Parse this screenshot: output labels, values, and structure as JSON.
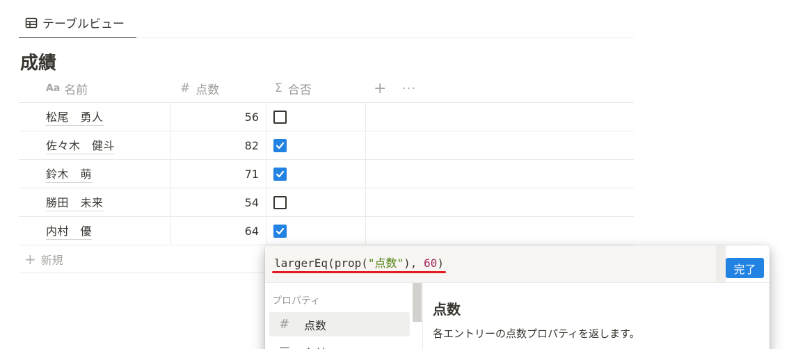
{
  "view_tab": {
    "label": "テーブルビュー",
    "icon": "table-icon"
  },
  "database": {
    "title": "成績"
  },
  "table": {
    "columns": [
      {
        "icon": "Aa",
        "label": "名前"
      },
      {
        "icon": "#",
        "label": "点数"
      },
      {
        "icon": "Σ",
        "label": "合否"
      }
    ],
    "add_column_icon": "+",
    "more_icon": "···",
    "rows": [
      {
        "name": "松尾　勇人",
        "score": "56",
        "pass": false
      },
      {
        "name": "佐々木　健斗",
        "score": "82",
        "pass": true
      },
      {
        "name": "鈴木　萌",
        "score": "71",
        "pass": true
      },
      {
        "name": "勝田　未来",
        "score": "54",
        "pass": false
      },
      {
        "name": "内村　優",
        "score": "64",
        "pass": true
      }
    ],
    "new_row_label": "新規"
  },
  "formula_popup": {
    "formula": {
      "fn_open": "largerEq(prop(",
      "arg_string": "\"点数\"",
      "mid": "), ",
      "arg_number": "60",
      "close": ")"
    },
    "done_label": "完了",
    "section_label": "プロパティ",
    "properties": [
      {
        "icon": "#",
        "label": "点数",
        "selected": true
      },
      {
        "icon": "☰",
        "label": "名前",
        "selected": false
      }
    ],
    "detail": {
      "title": "点数",
      "description": "各エントリーの点数プロパティを返します。"
    }
  },
  "colors": {
    "accent": "#2383e2",
    "text": "#37352f",
    "muted": "#9b9a97",
    "underline": "#e41b23",
    "string": "#4d7e0e",
    "number": "#a3285c"
  }
}
